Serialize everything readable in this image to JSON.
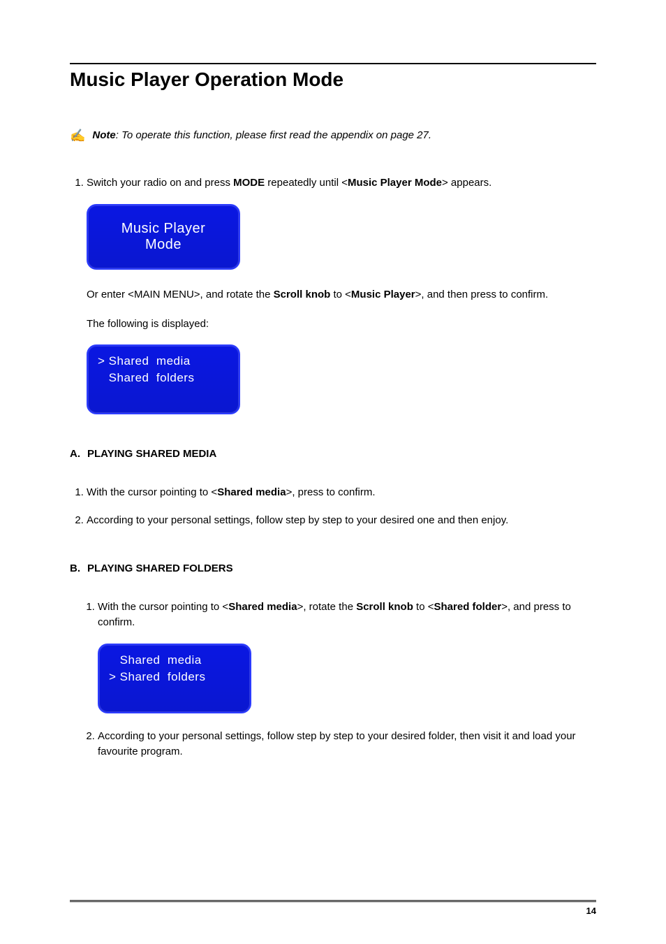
{
  "title": "Music Player Operation Mode",
  "note": {
    "label": "Note",
    "text": ": To operate this function, please first read the appendix on page 27."
  },
  "step1": {
    "pre": "Switch your radio on and press ",
    "b1": "MODE",
    "mid": " repeatedly until <",
    "b2": "Music Player Mode",
    "post": "> appears."
  },
  "screen1": {
    "line1": "Music Player",
    "line2": "Mode"
  },
  "after_screen1": {
    "line1_pre": "Or enter <MAIN MENU>, and rotate the ",
    "line1_b1": "Scroll knob",
    "line1_mid": " to <",
    "line1_b2": "Music Player",
    "line1_post": ">, and then press to confirm.",
    "line2": "The following is displayed:"
  },
  "screen2": {
    "row1": "> Shared  media",
    "row2": "   Shared  folders"
  },
  "sectionA": {
    "letter": "A.",
    "title": "PLAYING SHARED MEDIA",
    "s1_pre": "With the cursor pointing to <",
    "s1_b": "Shared media",
    "s1_post": ">, press to confirm.",
    "s2": "According to your personal settings, follow step by step to your desired one and then enjoy."
  },
  "sectionB": {
    "letter": "B.",
    "title": "PLAYING SHARED FOLDERS",
    "s1_pre": "With the cursor pointing to <",
    "s1_b1": "Shared media",
    "s1_mid1": ">, rotate the ",
    "s1_b2": "Scroll knob",
    "s1_mid2": " to <",
    "s1_b3": "Shared folder",
    "s1_post": ">, and press to confirm.",
    "s2": "According to your personal settings, follow step by step to your desired folder, then visit it and load your favourite program."
  },
  "screen3": {
    "row1": "   Shared  media",
    "row2": "> Shared  folders"
  },
  "page_number": "14"
}
